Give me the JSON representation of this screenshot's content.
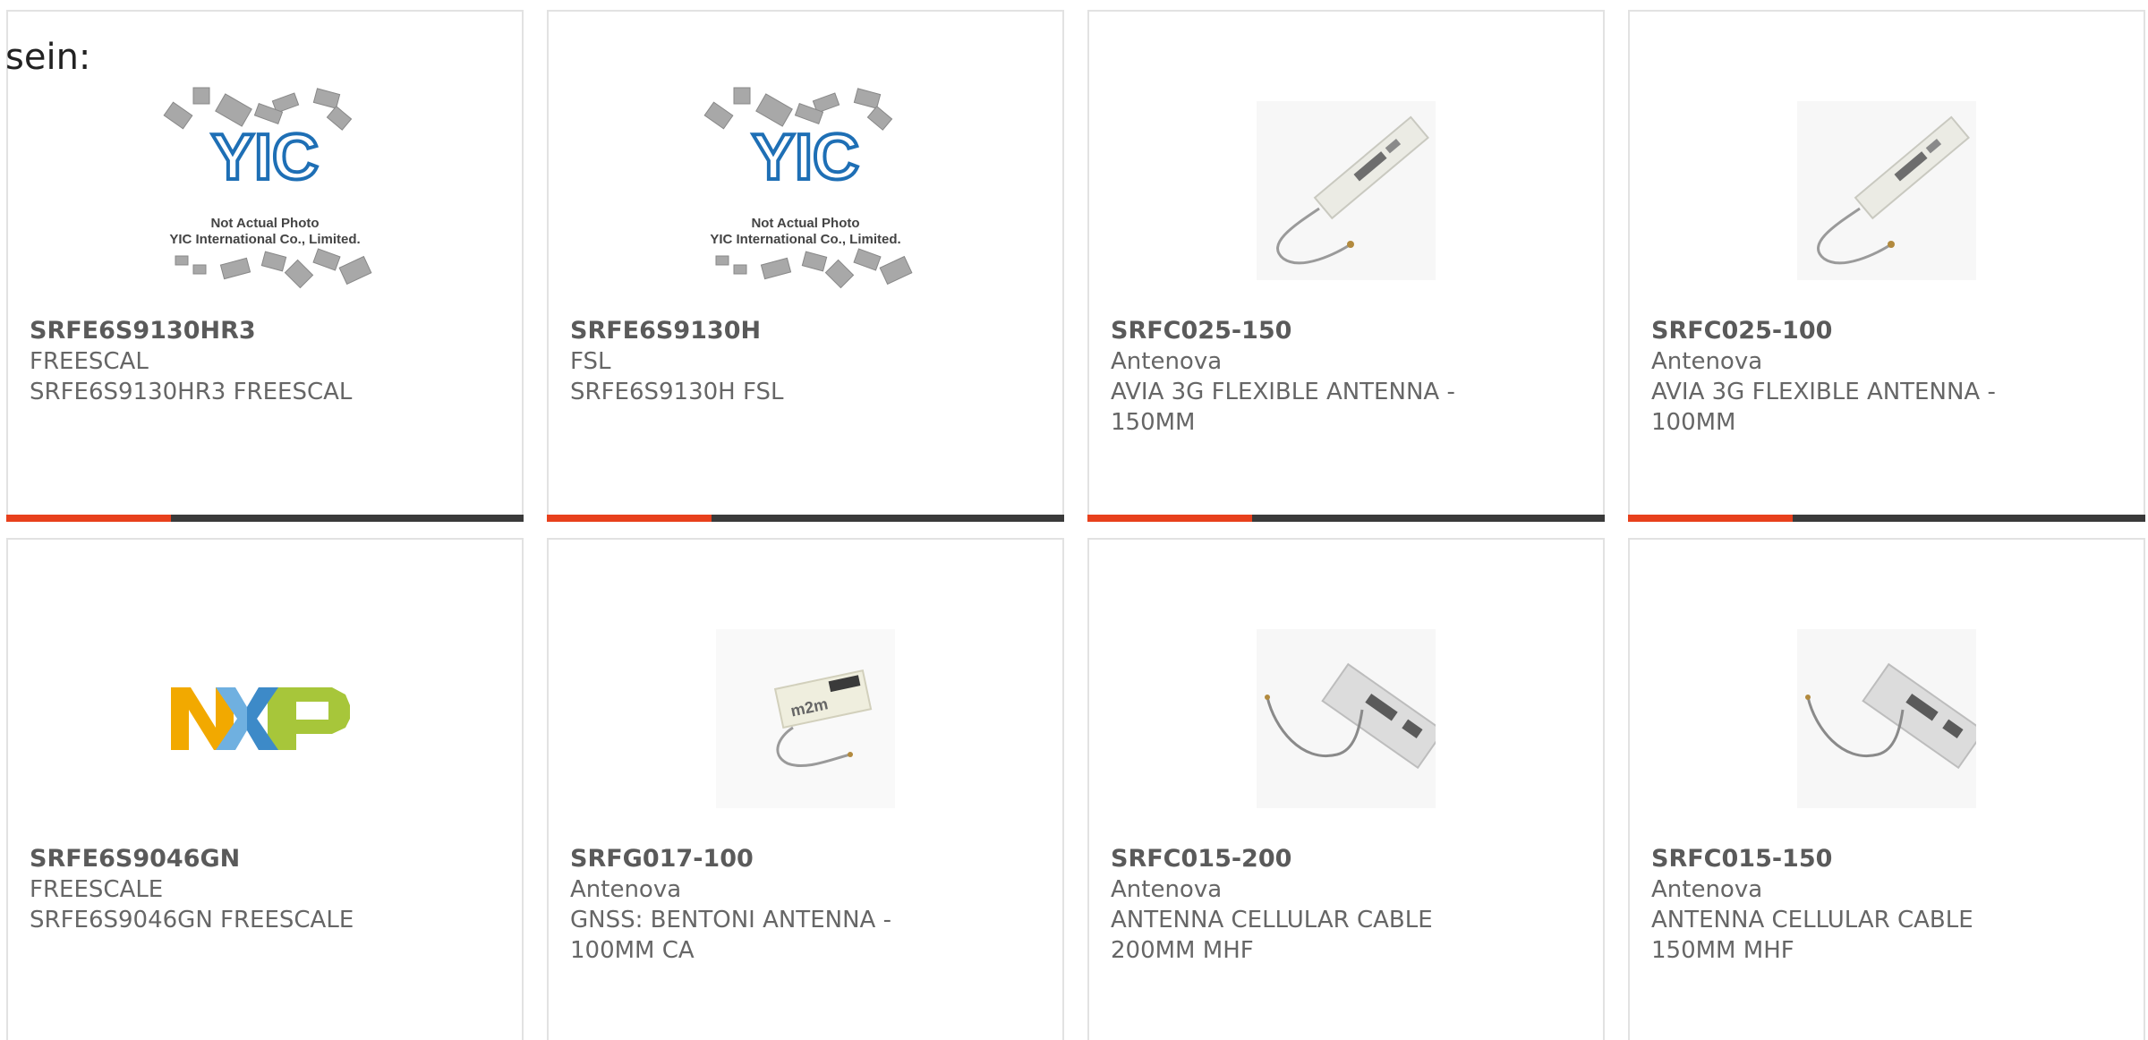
{
  "page": {
    "heading_fragment": "sein:"
  },
  "colors": {
    "accent": "#e8401c",
    "bar": "#3a3a3a",
    "card_border": "#e2e2e2",
    "text": "#666666"
  },
  "placeholder": {
    "line1": "Not Actual Photo",
    "line2": "YIC International Co., Limited."
  },
  "products": [
    {
      "part_number": "SRFE6S9130HR3",
      "manufacturer": "FREESCAL",
      "description": "SRFE6S9130HR3 FREESCAL",
      "image": "yic-placeholder-icon"
    },
    {
      "part_number": "SRFE6S9130H",
      "manufacturer": "FSL",
      "description": "SRFE6S9130H FSL",
      "image": "yic-placeholder-icon"
    },
    {
      "part_number": "SRFC025-150",
      "manufacturer": "Antenova",
      "description": "AVIA 3G FLEXIBLE ANTENNA - 150MM",
      "image": "flexible-antenna-icon"
    },
    {
      "part_number": "SRFC025-100",
      "manufacturer": "Antenova",
      "description": "AVIA 3G FLEXIBLE ANTENNA - 100MM",
      "image": "flexible-antenna-icon"
    },
    {
      "part_number": "SRFE6S9046GN",
      "manufacturer": "FREESCALE",
      "description": "SRFE6S9046GN FREESCALE",
      "image": "nxp-logo"
    },
    {
      "part_number": "SRFG017-100",
      "manufacturer": "Antenova",
      "description": "GNSS: BENTONI ANTENNA - 100MM CA",
      "image": "m2m-antenna-icon"
    },
    {
      "part_number": "SRFC015-200",
      "manufacturer": "Antenova",
      "description": "ANTENNA CELLULAR CABLE 200MM MHF",
      "image": "cellular-antenna-icon"
    },
    {
      "part_number": "SRFC015-150",
      "manufacturer": "Antenova",
      "description": "ANTENNA CELLULAR CABLE 150MM MHF",
      "image": "cellular-antenna-icon"
    }
  ]
}
